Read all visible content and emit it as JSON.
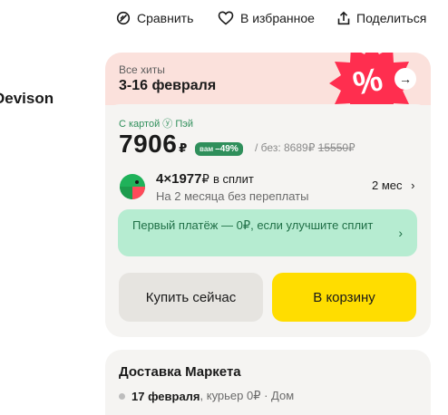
{
  "top_actions": {
    "compare": "Сравнить",
    "favorite": "В избранное",
    "share": "Поделиться"
  },
  "brand": "Devison",
  "promo": {
    "subtitle": "Все хиты",
    "title": "3-16 февраля",
    "badge_icon": "percent-badge-icon",
    "badge_color": "#ff2e4f"
  },
  "pricing": {
    "pay_label": "С картой ⓨ Пэй",
    "price": "7906",
    "currency": "₽",
    "discount_prefix": "вам",
    "discount": "–49%",
    "without_label": "/ без: 8689",
    "without_currency": "₽",
    "old_price": "15550",
    "old_currency": "₽",
    "accent_color": "#2f8f5b"
  },
  "split": {
    "icon": "split-pie-icon",
    "amount": "4×1977",
    "currency": "₽",
    "suffix": "в сплит",
    "subtitle": "На 2 месяца без переплаты",
    "months": "2 мес",
    "first_payment": "Первый платёж — 0₽, если улучшите сплит"
  },
  "buttons": {
    "buy_now": "Купить сейчас",
    "to_cart": "В корзину",
    "cart_color": "#ffdd00"
  },
  "delivery": {
    "title": "Доставка Маркета",
    "date": "17 февраля",
    "details": ", курьер 0₽ · Дом"
  }
}
